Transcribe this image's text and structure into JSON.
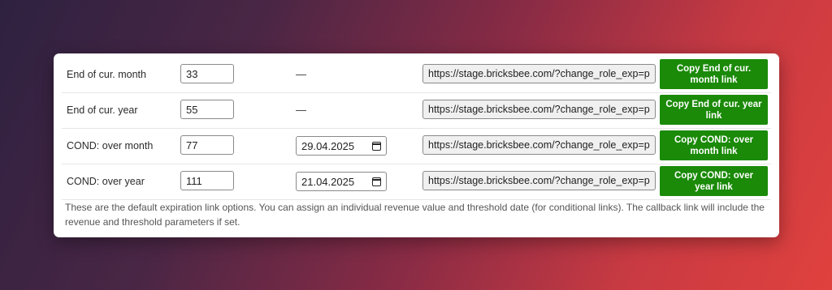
{
  "rows": [
    {
      "label": "End of cur. month",
      "value": "33",
      "date": "",
      "dash": "—",
      "url": "https://stage.bricksbee.com/?change_role_exp=paid",
      "button": "Copy End of cur. month link"
    },
    {
      "label": "End of cur. year",
      "value": "55",
      "date": "",
      "dash": "—",
      "url": "https://stage.bricksbee.com/?change_role_exp=paid",
      "button": "Copy End of cur. year link"
    },
    {
      "label": "COND: over month",
      "value": "77",
      "date": "29.04.2025",
      "dash": "",
      "url": "https://stage.bricksbee.com/?change_role_exp=paid",
      "button": "Copy COND: over month link"
    },
    {
      "label": "COND: over year",
      "value": "111",
      "date": "21.04.2025",
      "dash": "",
      "url": "https://stage.bricksbee.com/?change_role_exp=paid",
      "button": "Copy COND: over year link"
    }
  ],
  "note": "These are the default expiration link options. You can assign an individual revenue value and threshold date (for conditional links). The callback link will include the revenue and threshold parameters if set.",
  "colors": {
    "button": "#1a8a08",
    "panel": "#ffffff"
  },
  "icons": {
    "date": "calendar-icon"
  }
}
